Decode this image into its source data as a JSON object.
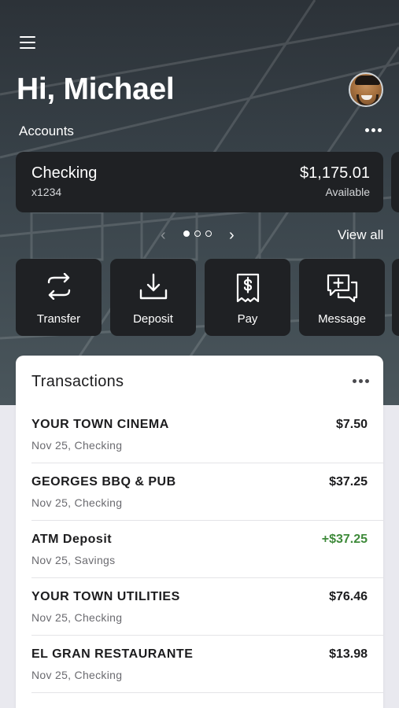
{
  "header": {
    "greeting": "Hi, Michael",
    "menu_icon": "hamburger-menu-icon",
    "avatar_icon": "user-avatar"
  },
  "accounts": {
    "label": "Accounts",
    "more_icon": "more-horizontal-icon",
    "view_all": "View all",
    "page_current": 1,
    "page_total": 3,
    "card": {
      "name": "Checking",
      "number": "x1234",
      "balance": "$1,175.01",
      "balance_label": "Available"
    }
  },
  "actions": [
    {
      "label": "Transfer",
      "icon": "transfer-arrows-icon"
    },
    {
      "label": "Deposit",
      "icon": "deposit-download-icon"
    },
    {
      "label": "Pay",
      "icon": "pay-bill-dollar-icon"
    },
    {
      "label": "Message",
      "icon": "message-plus-icon"
    }
  ],
  "transactions": {
    "title": "Transactions",
    "more_icon": "more-horizontal-icon",
    "items": [
      {
        "merchant": "YOUR TOWN CINEMA",
        "detail": "Nov 25, Checking",
        "amount": "$7.50",
        "positive": false
      },
      {
        "merchant": "GEORGES BBQ & PUB",
        "detail": "Nov 25, Checking",
        "amount": "$37.25",
        "positive": false
      },
      {
        "merchant": "ATM Deposit",
        "detail": "Nov 25, Savings",
        "amount": "+$37.25",
        "positive": true
      },
      {
        "merchant": "YOUR TOWN UTILITIES",
        "detail": "Nov 25, Checking",
        "amount": "$76.46",
        "positive": false
      },
      {
        "merchant": "EL GRAN RESTAURANTE",
        "detail": "Nov 25, Checking",
        "amount": "$13.98",
        "positive": false
      }
    ]
  },
  "colors": {
    "hero_bg": "#323a40",
    "card_bg": "#1f2124",
    "positive_amount": "#3e8a3a",
    "page_bg": "#e9e9ef"
  }
}
